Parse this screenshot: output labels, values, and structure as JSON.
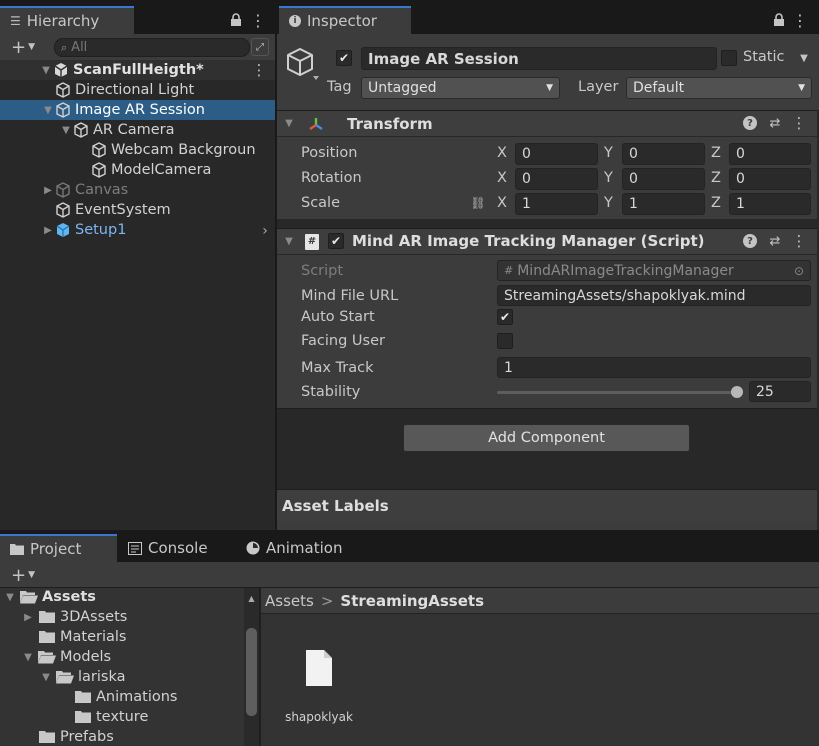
{
  "hierarchy": {
    "tab_label": "Hierarchy",
    "search_placeholder": "All",
    "scene_name": "ScanFullHeigth*",
    "items": [
      {
        "label": "Directional Light",
        "indent": 1,
        "arrow": "",
        "style": "normal"
      },
      {
        "label": "Image AR Session",
        "indent": 1,
        "arrow": "down",
        "style": "selected"
      },
      {
        "label": "AR Camera",
        "indent": 2,
        "arrow": "down",
        "style": "normal"
      },
      {
        "label": "Webcam Backgroun",
        "indent": 3,
        "arrow": "",
        "style": "normal"
      },
      {
        "label": "ModelCamera",
        "indent": 3,
        "arrow": "",
        "style": "normal"
      },
      {
        "label": "Canvas",
        "indent": 1,
        "arrow": "right",
        "style": "dim"
      },
      {
        "label": "EventSystem",
        "indent": 1,
        "arrow": "",
        "style": "normal"
      },
      {
        "label": "Setup1",
        "indent": 1,
        "arrow": "right",
        "style": "prefab"
      }
    ]
  },
  "inspector": {
    "tab_label": "Inspector",
    "object_name": "Image AR Session",
    "static_label": "Static",
    "tag_label": "Tag",
    "tag_value": "Untagged",
    "layer_label": "Layer",
    "layer_value": "Default",
    "transform": {
      "title": "Transform",
      "rows": [
        {
          "label": "Position",
          "x": "0",
          "y": "0",
          "z": "0"
        },
        {
          "label": "Rotation",
          "x": "0",
          "y": "0",
          "z": "0"
        },
        {
          "label": "Scale",
          "x": "1",
          "y": "1",
          "z": "1"
        }
      ],
      "axis_x": "X",
      "axis_y": "Y",
      "axis_z": "Z"
    },
    "script_component": {
      "title": "Mind AR Image Tracking Manager (Script)",
      "script_label": "Script",
      "script_value": "MindARImageTrackingManager",
      "mind_file_label": "Mind File URL",
      "mind_file_value": "StreamingAssets/shapoklyak.mind",
      "auto_start_label": "Auto Start",
      "auto_start": true,
      "facing_user_label": "Facing User",
      "facing_user": false,
      "max_track_label": "Max Track",
      "max_track_value": "1",
      "stability_label": "Stability",
      "stability_value": "25",
      "stability_fraction": 1.0
    },
    "add_component_label": "Add Component",
    "asset_labels_label": "Asset Labels"
  },
  "bottom": {
    "tabs": [
      {
        "label": "Project",
        "icon": "folder-icon"
      },
      {
        "label": "Console",
        "icon": "console-icon"
      },
      {
        "label": "Animation",
        "icon": "animation-icon"
      }
    ],
    "tree": [
      {
        "label": "Assets",
        "indent": 0,
        "arrow": "down",
        "open": true,
        "bold": true
      },
      {
        "label": "3DAssets",
        "indent": 1,
        "arrow": "right",
        "open": false,
        "bold": false
      },
      {
        "label": "Materials",
        "indent": 1,
        "arrow": "",
        "open": false,
        "bold": false
      },
      {
        "label": "Models",
        "indent": 1,
        "arrow": "down",
        "open": true,
        "bold": false
      },
      {
        "label": "lariska",
        "indent": 2,
        "arrow": "down",
        "open": true,
        "bold": false
      },
      {
        "label": "Animations",
        "indent": 3,
        "arrow": "",
        "open": false,
        "bold": false
      },
      {
        "label": "texture",
        "indent": 3,
        "arrow": "",
        "open": false,
        "bold": false
      },
      {
        "label": "Prefabs",
        "indent": 1,
        "arrow": "",
        "open": false,
        "bold": false
      }
    ],
    "breadcrumb_root": "Assets",
    "breadcrumb_sep": ">",
    "breadcrumb_current": "StreamingAssets",
    "file_name": "shapoklyak"
  },
  "colors": {
    "selection": "#2c5d87",
    "prefab": "#7bb6f2",
    "tab_accent": "#3a78d0"
  }
}
